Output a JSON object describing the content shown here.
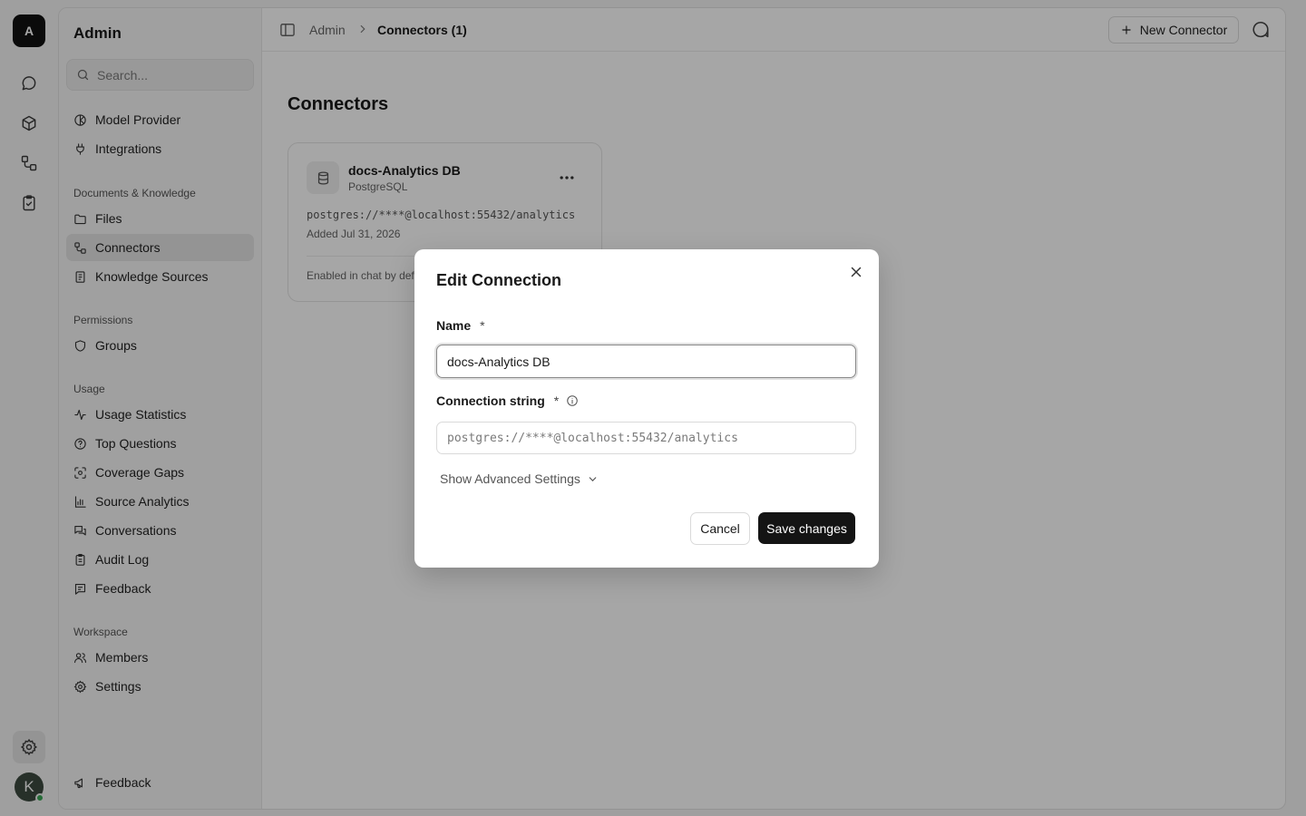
{
  "rail": {
    "logo_letter": "A",
    "avatar_letter": "K",
    "icons": [
      "chat-icon",
      "cube-icon",
      "connector-icon",
      "clipboard-check-icon",
      "gear-icon"
    ]
  },
  "sidebar": {
    "title": "Admin",
    "search_placeholder": "Search...",
    "top_items": [
      {
        "label": "Model Provider",
        "icon": "model-icon"
      },
      {
        "label": "Integrations",
        "icon": "plug-icon"
      }
    ],
    "sections": [
      {
        "title": "Documents & Knowledge",
        "items": [
          {
            "label": "Files",
            "icon": "folder-icon"
          },
          {
            "label": "Connectors",
            "icon": "connector-icon",
            "active": true
          },
          {
            "label": "Knowledge Sources",
            "icon": "book-icon"
          }
        ]
      },
      {
        "title": "Permissions",
        "items": [
          {
            "label": "Groups",
            "icon": "shield-icon"
          }
        ]
      },
      {
        "title": "Usage",
        "items": [
          {
            "label": "Usage Statistics",
            "icon": "activity-icon"
          },
          {
            "label": "Top Questions",
            "icon": "help-circle-icon"
          },
          {
            "label": "Coverage Gaps",
            "icon": "scan-icon"
          },
          {
            "label": "Source Analytics",
            "icon": "bar-chart-icon"
          },
          {
            "label": "Conversations",
            "icon": "messages-icon"
          },
          {
            "label": "Audit Log",
            "icon": "clipboard-icon"
          },
          {
            "label": "Feedback",
            "icon": "message-square-icon"
          }
        ]
      },
      {
        "title": "Workspace",
        "items": [
          {
            "label": "Members",
            "icon": "users-icon"
          },
          {
            "label": "Settings",
            "icon": "gear-icon"
          }
        ]
      }
    ],
    "footer_item": {
      "label": "Feedback",
      "icon": "megaphone-icon"
    }
  },
  "topbar": {
    "breadcrumb_root": "Admin",
    "breadcrumb_current": "Connectors (1)",
    "new_button_label": "New Connector"
  },
  "main": {
    "title": "Connectors",
    "card": {
      "name": "docs-Analytics DB",
      "type": "PostgreSQL",
      "connection": "postgres://****@localhost:55432/analytics",
      "added": "Added Jul 31, 2026",
      "footer": "Enabled in chat by default"
    }
  },
  "modal": {
    "title": "Edit Connection",
    "name_label": "Name",
    "required_mark": "*",
    "name_value": "docs-Analytics DB",
    "conn_label": "Connection string",
    "conn_placeholder": "postgres://****@localhost:55432/analytics",
    "advanced_label": "Show Advanced Settings",
    "cancel_label": "Cancel",
    "save_label": "Save changes"
  }
}
